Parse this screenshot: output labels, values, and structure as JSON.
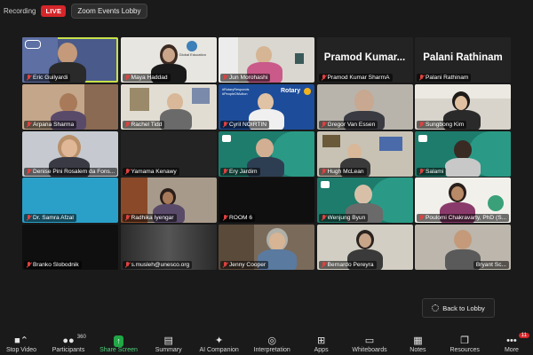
{
  "topbar": {
    "recording_label": "Recording",
    "live_label": "LIVE",
    "lobby_label": "Zoom Events Lobby"
  },
  "participants": [
    {
      "name": "Eric Guilyardi"
    },
    {
      "name": "Maya Haddad"
    },
    {
      "name": "Jun Morohashi"
    },
    {
      "name": "Pramod Kumar SharmA",
      "display": "Pramod  Kumar..."
    },
    {
      "name": "Palani Rathinam",
      "display": "Palani Rathinam"
    },
    {
      "name": "Arpana Sharma"
    },
    {
      "name": "Rachel Tidd"
    },
    {
      "name": "Cyril NOIRTIN"
    },
    {
      "name": "Gregor Van Essen"
    },
    {
      "name": "Sungbong Kim"
    },
    {
      "name": "Denise Pini Rosalem da Fons..."
    },
    {
      "name": "Yamama Kenawy"
    },
    {
      "name": "Ery Jardim"
    },
    {
      "name": "Hugh McLean"
    },
    {
      "name": "Salami"
    },
    {
      "name": "Dr. Samra Afzal"
    },
    {
      "name": "Radhika Iyengar"
    },
    {
      "name": "ROOM 6"
    },
    {
      "name": "Wenjung Byun"
    },
    {
      "name": "Poulomi Chakravarty, PhD (S..."
    },
    {
      "name": "Branko Slobodnik"
    },
    {
      "name": "s.musleh@unesco.org"
    },
    {
      "name": "Jenny Cooper"
    },
    {
      "name": "Bernardo Pereyra"
    },
    {
      "name": "Bryant Sc..."
    }
  ],
  "tile_text": {
    "rotary": "Rotary",
    "rotary_tag": "#RotaryResponds #PeopleOfAction",
    "unesco_institute": "Global Education"
  },
  "back_to_lobby": "Back to Lobby",
  "toolbar": {
    "stop_video": "Stop Video",
    "participants": "Participants",
    "participants_count": "360",
    "share_screen": "Share Screen",
    "summary": "Summary",
    "ai_companion": "AI Companion",
    "interpretation": "Interpretation",
    "apps": "Apps",
    "whiteboards": "Whiteboards",
    "notes": "Notes",
    "resources": "Resources",
    "more": "More",
    "more_badge": "11"
  },
  "icons": {
    "video": "video-camera-icon",
    "participants": "people-icon",
    "share": "share-arrow-icon",
    "summary": "document-icon",
    "ai": "sparkle-icon",
    "interpretation": "globe-icon",
    "apps": "apps-grid-icon",
    "whiteboards": "whiteboard-icon",
    "notes": "notes-icon",
    "resources": "resources-icon",
    "more": "ellipsis-icon",
    "mic": "muted-mic-icon"
  }
}
